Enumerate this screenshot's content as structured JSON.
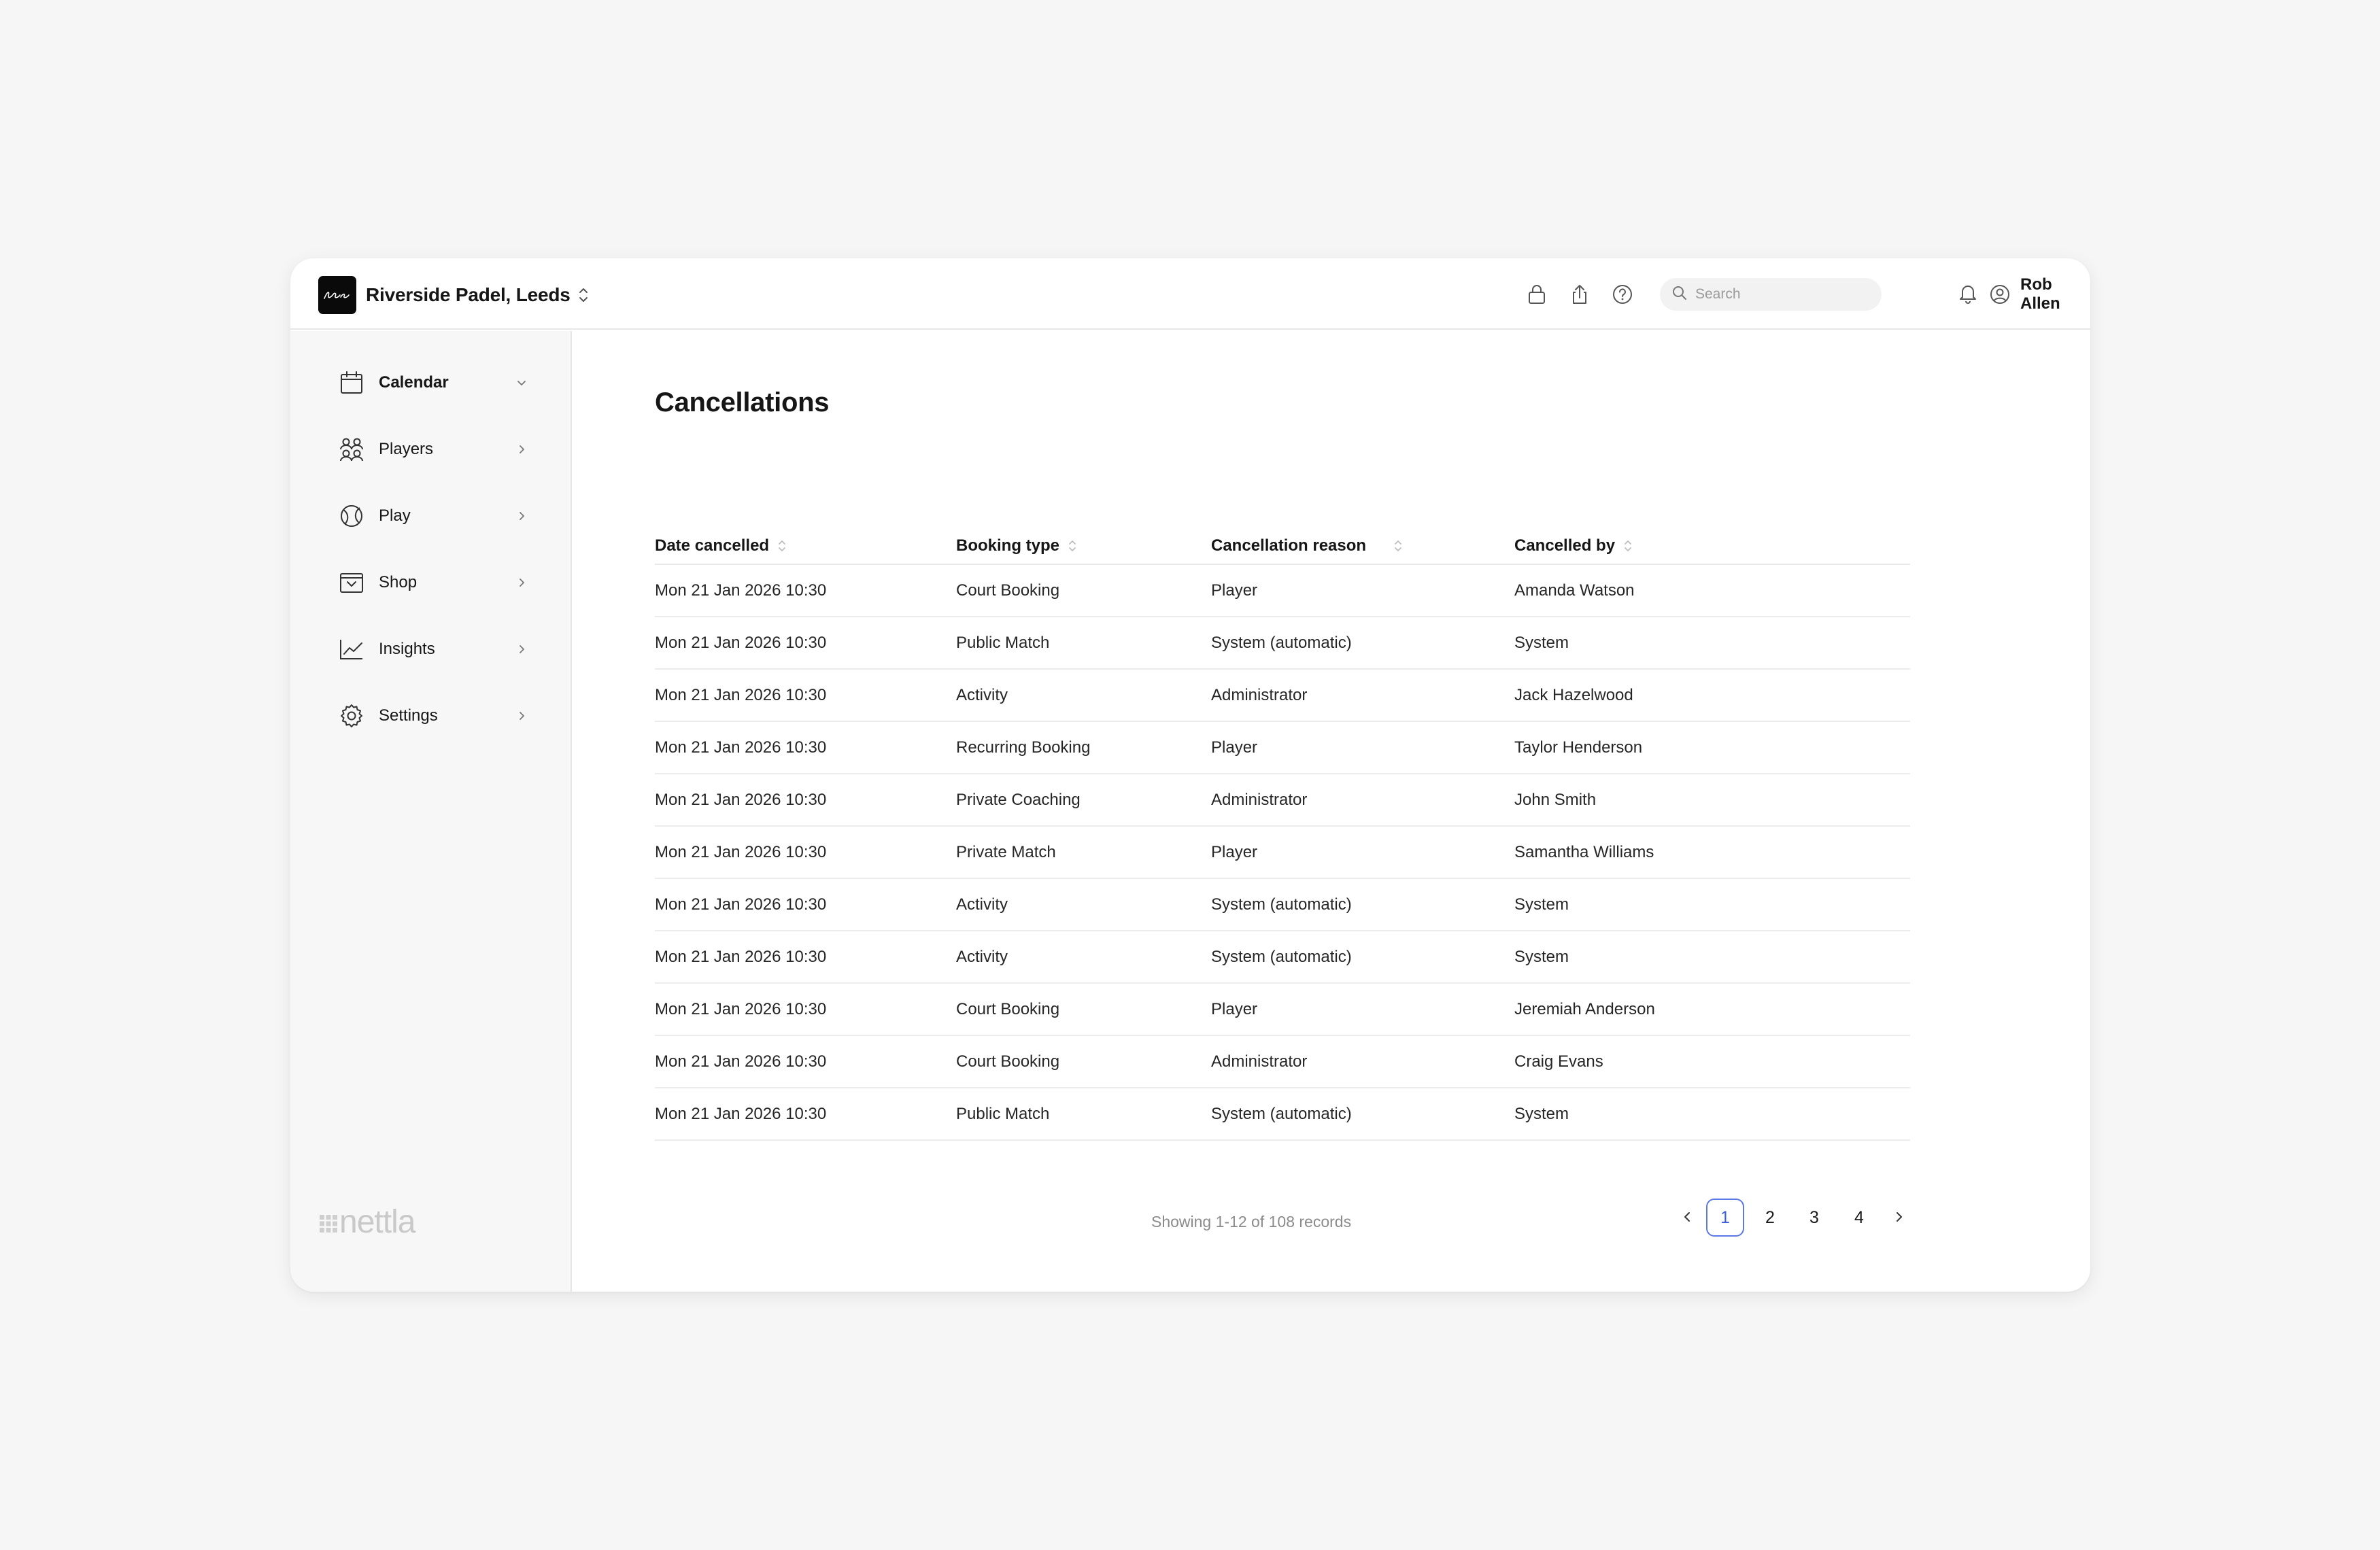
{
  "header": {
    "venue_name": "Riverside Padel, Leeds",
    "search_placeholder": "Search",
    "user_name": "Rob Allen",
    "icons": [
      "lock-icon",
      "share-icon",
      "help-icon",
      "search-icon",
      "bell-icon",
      "user-circle-icon"
    ]
  },
  "sidebar": {
    "items": [
      {
        "label": "Calendar",
        "icon": "calendar-icon",
        "active": true,
        "chevron": "down"
      },
      {
        "label": "Players",
        "icon": "players-icon",
        "active": false,
        "chevron": "right"
      },
      {
        "label": "Play",
        "icon": "ball-icon",
        "active": false,
        "chevron": "right"
      },
      {
        "label": "Shop",
        "icon": "shop-icon",
        "active": false,
        "chevron": "right"
      },
      {
        "label": "Insights",
        "icon": "chart-icon",
        "active": false,
        "chevron": "right"
      },
      {
        "label": "Settings",
        "icon": "gear-icon",
        "active": false,
        "chevron": "right"
      }
    ],
    "footer_logo": "nettla"
  },
  "main": {
    "title": "Cancellations",
    "columns": [
      "Date cancelled",
      "Booking type",
      "Cancellation reason",
      "Cancelled by"
    ],
    "rows": [
      [
        "Mon 21 Jan 2026 10:30",
        "Court Booking",
        "Player",
        "Amanda Watson"
      ],
      [
        "Mon 21 Jan 2026 10:30",
        "Public Match",
        "System (automatic)",
        "System"
      ],
      [
        "Mon 21 Jan 2026 10:30",
        "Activity",
        "Administrator",
        "Jack Hazelwood"
      ],
      [
        "Mon 21 Jan 2026 10:30",
        "Recurring Booking",
        "Player",
        "Taylor Henderson"
      ],
      [
        "Mon 21 Jan 2026 10:30",
        "Private Coaching",
        "Administrator",
        "John Smith"
      ],
      [
        "Mon 21 Jan 2026 10:30",
        "Private Match",
        "Player",
        "Samantha Williams"
      ],
      [
        "Mon 21 Jan 2026 10:30",
        "Activity",
        "System (automatic)",
        "System"
      ],
      [
        "Mon 21 Jan 2026 10:30",
        "Activity",
        "System (automatic)",
        "System"
      ],
      [
        "Mon 21 Jan 2026 10:30",
        "Court Booking",
        "Player",
        "Jeremiah Anderson"
      ],
      [
        "Mon 21 Jan 2026 10:30",
        "Court Booking",
        "Administrator",
        "Craig Evans"
      ],
      [
        "Mon 21 Jan 2026 10:30",
        "Public Match",
        "System (automatic)",
        "System"
      ]
    ],
    "records_text": "Showing 1-12 of 108 records",
    "pagination": {
      "pages": [
        "1",
        "2",
        "3",
        "4"
      ],
      "current": "1"
    }
  },
  "colors": {
    "accent": "#3f5fd8",
    "background": "#f6f6f6",
    "sidebar": "#f7f7f7"
  }
}
